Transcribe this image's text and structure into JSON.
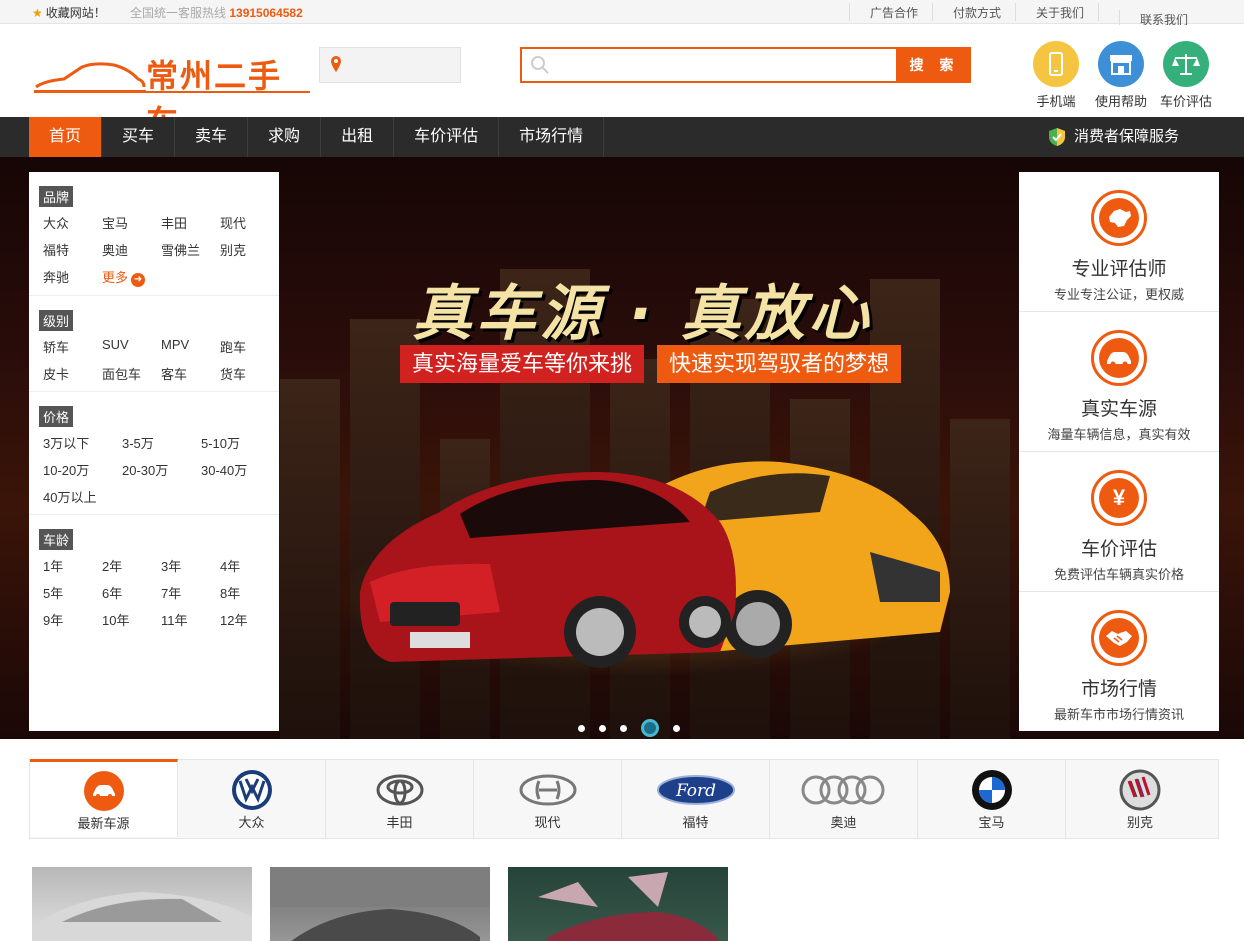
{
  "topbar": {
    "favorite": "收藏网站！",
    "hotline_label": "全国统一客服热线",
    "hotline_number": "13915064582",
    "links": [
      "广告合作",
      "付款方式",
      "关于我们",
      "联系我们"
    ]
  },
  "header": {
    "logo_text": "常州二手车",
    "search_placeholder": "",
    "search_button": "搜 索",
    "quick_links": [
      {
        "label": "手机端",
        "icon": "mobile-icon",
        "color": "#f5c542"
      },
      {
        "label": "使用帮助",
        "icon": "store-icon",
        "color": "#3d8fd8"
      },
      {
        "label": "车价评估",
        "icon": "scale-icon",
        "color": "#35b07a"
      }
    ]
  },
  "nav": {
    "items": [
      "首页",
      "买车",
      "卖车",
      "求购",
      "出租",
      "车价评估",
      "市场行情"
    ],
    "active_index": 0,
    "guarantee": "消费者保障服务"
  },
  "banner": {
    "slogan": "真车源 · 真放心",
    "sub1": "真实海量爱车等你来挑",
    "sub2": "快速实现驾驭者的梦想",
    "slide_count": 5,
    "active_slide": 3
  },
  "filters": {
    "brand": {
      "title": "品牌",
      "items": [
        "大众",
        "宝马",
        "丰田",
        "现代",
        "福特",
        "奥迪",
        "雪佛兰",
        "别克",
        "奔驰"
      ],
      "more": "更多"
    },
    "level": {
      "title": "级别",
      "items": [
        "轿车",
        "SUV",
        "MPV",
        "跑车",
        "皮卡",
        "面包车",
        "客车",
        "货车"
      ]
    },
    "price": {
      "title": "价格",
      "items": [
        "3万以下",
        "3-5万",
        "5-10万",
        "10-20万",
        "20-30万",
        "30-40万",
        "40万以上"
      ]
    },
    "age": {
      "title": "车龄",
      "items": [
        "1年",
        "2年",
        "3年",
        "4年",
        "5年",
        "6年",
        "7年",
        "8年",
        "9年",
        "10年",
        "11年",
        "12年"
      ]
    }
  },
  "services": [
    {
      "title": "专业评估师",
      "desc": "专业专注公证，更权威",
      "icon": "china-map-icon"
    },
    {
      "title": "真实车源",
      "desc": "海量车辆信息，真实有效",
      "icon": "car-icon"
    },
    {
      "title": "车价评估",
      "desc": "免费评估车辆真实价格",
      "icon": "yen-icon"
    },
    {
      "title": "市场行情",
      "desc": "最新车市市场行情资讯",
      "icon": "handshake-icon"
    }
  ],
  "brand_tabs": [
    "最新车源",
    "大众",
    "丰田",
    "现代",
    "福特",
    "奥迪",
    "宝马",
    "别克"
  ],
  "colors": {
    "accent": "#ee5a10",
    "nav_bg": "#2b2b2b"
  }
}
